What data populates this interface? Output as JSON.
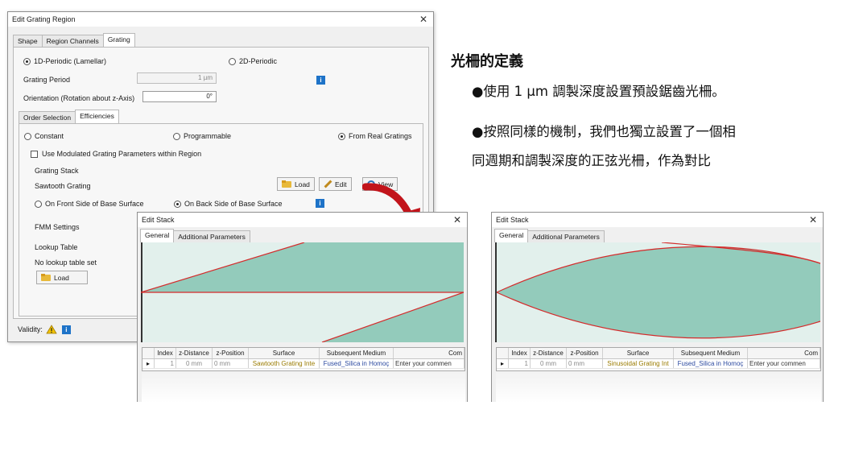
{
  "annotation": {
    "title": "光柵的定義",
    "bullet1": "●使用 1 µm 調製深度設置預設鋸齒光柵。",
    "bullet2_line1": "●按照同樣的機制，我們也獨立設置了一個相",
    "bullet2_line2": "同週期和調製深度的正弦光柵，作為對比"
  },
  "main_dialog": {
    "title": "Edit Grating Region",
    "close": "✕",
    "tabs": [
      "Shape",
      "Region Channels",
      "Grating"
    ],
    "radio_1d": "1D-Periodic (Lamellar)",
    "radio_2d": "2D-Periodic",
    "grating_period_label": "Grating Period",
    "grating_period_value": "1 µm",
    "orientation_label": "Orientation (Rotation about z-Axis)",
    "orientation_value": "0°",
    "sub_tabs": [
      "Order Selection",
      "Efficiencies"
    ],
    "eff_constant": "Constant",
    "eff_programmable": "Programmable",
    "eff_real": "From Real Gratings",
    "use_modulated": "Use Modulated Grating Parameters within Region",
    "grating_stack_label": "Grating Stack",
    "stack_name": "Sawtooth Grating",
    "load_button": "Load",
    "edit_button": "Edit",
    "view_button": "View",
    "front_side": "On Front Side of Base Surface",
    "back_side": "On Back Side of Base Surface",
    "fmm_settings": "FMM Settings",
    "lookup_table_label": "Lookup Table",
    "lookup_status": "No lookup table set",
    "lookup_load": "Load",
    "validity_label": "Validity:",
    "info_glyph": "i"
  },
  "stack_left": {
    "title": "Edit Stack",
    "close": "✕",
    "tabs": [
      "General",
      "Additional Parameters"
    ],
    "columns": [
      "Index",
      "z-Distance",
      "z-Position",
      "Surface",
      "Subsequent Medium",
      "Com"
    ],
    "row": {
      "index": "1",
      "z_distance": "0 mm",
      "z_position": "0 mm",
      "surface": "Sawtooth Grating Inte",
      "medium": "Fused_Silica in Homoç",
      "comment": "Enter your commen"
    }
  },
  "stack_right": {
    "title": "Edit Stack",
    "close": "✕",
    "tabs": [
      "General",
      "Additional Parameters"
    ],
    "columns": [
      "Index",
      "z-Distance",
      "z-Position",
      "Surface",
      "Subsequent Medium",
      "Com"
    ],
    "row": {
      "index": "1",
      "z_distance": "0 mm",
      "z_position": "0 mm",
      "surface": "Sinusoidal Grating Int",
      "medium": "Fused_Silica in Homoç",
      "comment": "Enter your commen"
    }
  },
  "colors": {
    "profile_fill": "#93cbbb",
    "profile_background": "#e2f0ec",
    "profile_line": "#d42b2b",
    "arrow": "#c2141b",
    "info_blue": "#1e73c8",
    "warning_yellow": "#f2c200"
  },
  "icons": [
    "radio-icon",
    "checkbox-icon",
    "folder-icon",
    "pencil-icon",
    "magnifier-icon",
    "info-icon",
    "warning-icon",
    "close-icon",
    "row-pointer-icon",
    "arrow-icon"
  ]
}
